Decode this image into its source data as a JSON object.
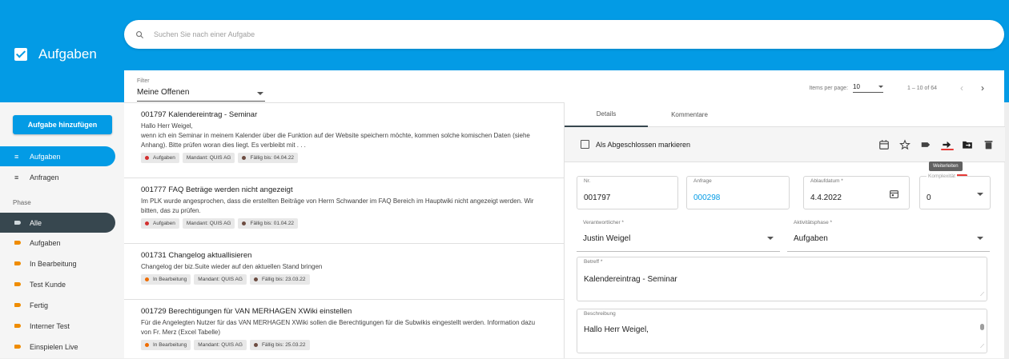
{
  "app": {
    "title": "Aufgaben"
  },
  "search": {
    "placeholder": "Suchen Sie nach einer Aufgabe"
  },
  "sidebar": {
    "add_button": "Aufgabe hinzufügen",
    "top_items": [
      {
        "label": "Aufgaben",
        "icon": "list-icon",
        "active": true
      },
      {
        "label": "Anfragen",
        "icon": "list-icon",
        "active": false
      }
    ],
    "phase_label": "Phase",
    "phase_items": [
      {
        "label": "Alle",
        "active": true
      },
      {
        "label": "Aufgaben"
      },
      {
        "label": "In Bearbeitung"
      },
      {
        "label": "Test Kunde"
      },
      {
        "label": "Fertig"
      },
      {
        "label": "Interner Test"
      },
      {
        "label": "Einspielen Live"
      }
    ]
  },
  "filter": {
    "label": "Filter",
    "value": "Meine Offenen"
  },
  "pager": {
    "items_label": "Items per page:",
    "per_page": "10",
    "range": "1 – 10 of 64"
  },
  "tasks": [
    {
      "title": "001797 Kalendereintrag - Seminar",
      "desc": "Hallo Herr Weigel,\nwenn ich ein Seminar in meinem Kalender über die Funktion auf der Website speichern möchte, kommen solche komischen Daten (siehe Anhang). Bitte prüfen woran dies liegt. Es verbleibt mit . . .",
      "chips": [
        {
          "label": "Aufgaben",
          "color": "#d32f2f"
        },
        {
          "label": "Mandant: QUIS AG"
        },
        {
          "label": "Fällig bis: 04.04.22",
          "color": "#6d4c41"
        }
      ]
    },
    {
      "title": "001777 FAQ Beträge werden nicht angezeigt",
      "desc": "Im PLK wurde angesprochen, dass die erstellten Beiträge von Herrn Schwander im FAQ Bereich im Hauptwiki nicht angezeigt werden. Wir bitten, das zu prüfen.",
      "chips": [
        {
          "label": "Aufgaben",
          "color": "#d32f2f"
        },
        {
          "label": "Mandant: QUIS AG"
        },
        {
          "label": "Fällig bis: 01.04.22",
          "color": "#6d4c41"
        }
      ]
    },
    {
      "title": "001731 Changelog aktuallisieren",
      "desc": "Changelog der biz.Suite wieder auf den aktuellen Stand bringen",
      "chips": [
        {
          "label": "In Bearbeitung",
          "color": "#ef6c00"
        },
        {
          "label": "Mandant: QUIS AG"
        },
        {
          "label": "Fällig bis: 23.03.22",
          "color": "#6d4c41"
        }
      ]
    },
    {
      "title": "001729 Berechtigungen für VAN MERHAGEN XWiki einstellen",
      "desc": "Für die Angelegten Nutzer für das VAN MERHAGEN XWiki sollen die Berechtigungen für die Subwikis eingestellt werden. Information dazu von Fr. Merz (Excel Tabelle)",
      "chips": [
        {
          "label": "In Bearbeitung",
          "color": "#ef6c00"
        },
        {
          "label": "Mandant: QUIS AG"
        },
        {
          "label": "Fällig bis: 25.03.22",
          "color": "#6d4c41"
        }
      ]
    }
  ],
  "detail": {
    "tabs": [
      "Details",
      "Kommentare"
    ],
    "mark_done": "Als Abgeschlossen markieren",
    "tooltip": "Weiterleiten",
    "fields": {
      "nr": {
        "label": "Nr.",
        "value": "001797"
      },
      "anfrage": {
        "label": "Anfrage",
        "value": "000298"
      },
      "ablauf": {
        "label": "Ablaufdatum *",
        "value": "4.4.2022"
      },
      "komplexitaet": {
        "label": "Komplexität",
        "value": "0"
      },
      "verantwortlicher": {
        "label": "Verantwortlicher *",
        "value": "Justin Weigel"
      },
      "phase": {
        "label": "Aktivitätsphase *",
        "value": "Aufgaben"
      },
      "betreff": {
        "label": "Betreff *",
        "value": "Kalendereintrag - Seminar"
      },
      "beschreibung": {
        "label": "Beschreibung",
        "value": "Hallo Herr Weigel,"
      }
    }
  },
  "colors": {
    "primary": "#039be5",
    "dark": "#37474f",
    "tag": "#ef8c00"
  }
}
